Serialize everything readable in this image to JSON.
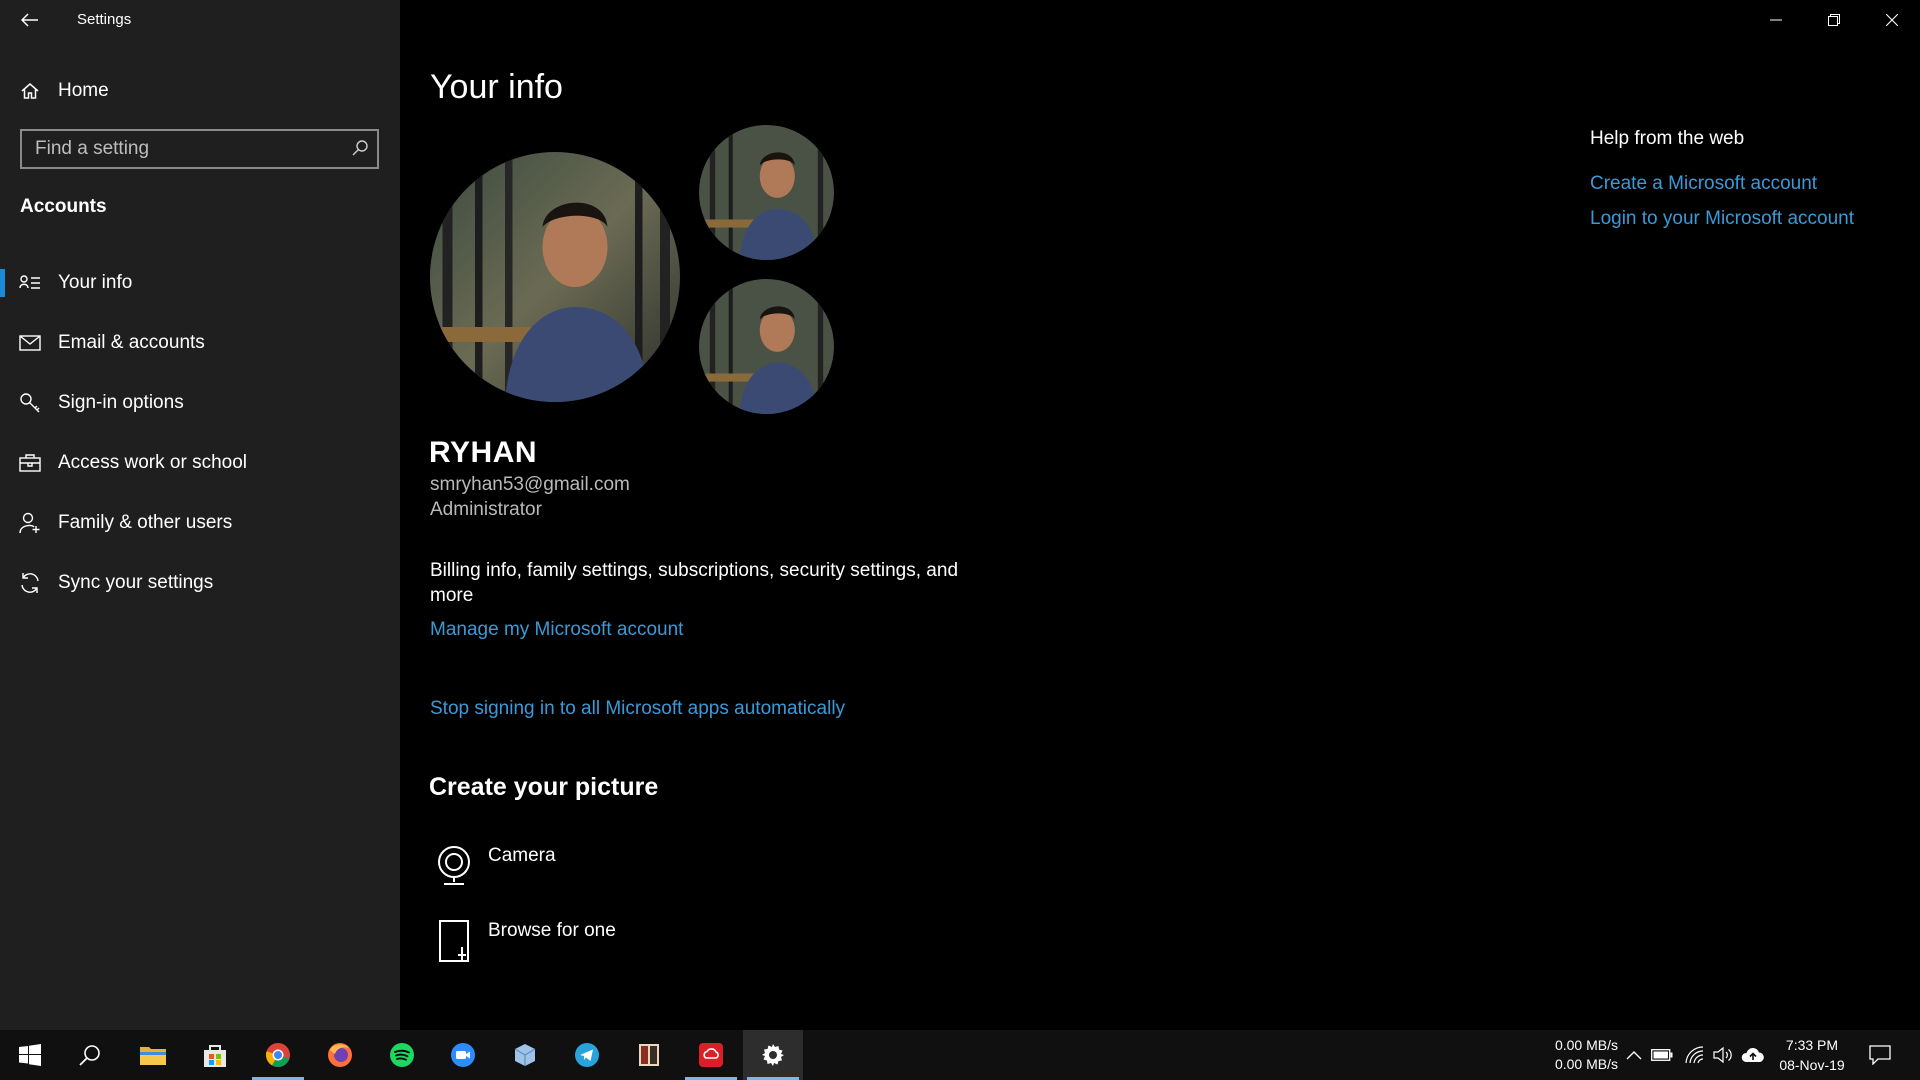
{
  "window": {
    "title": "Settings",
    "controls": [
      "minimize-icon",
      "restore-icon",
      "close-icon"
    ]
  },
  "sidebar": {
    "home_label": "Home",
    "search_placeholder": "Find a setting",
    "section_title": "Accounts",
    "items": [
      {
        "label": "Your info",
        "icon": "contact-info-icon",
        "active": true
      },
      {
        "label": "Email & accounts",
        "icon": "mail-icon",
        "active": false
      },
      {
        "label": "Sign-in options",
        "icon": "key-icon",
        "active": false
      },
      {
        "label": "Access work or school",
        "icon": "briefcase-icon",
        "active": false
      },
      {
        "label": "Family & other users",
        "icon": "add-person-icon",
        "active": false
      },
      {
        "label": "Sync your settings",
        "icon": "sync-icon",
        "active": false
      }
    ]
  },
  "main": {
    "title": "Your info",
    "user": {
      "name": "RYHAN",
      "email": "smryhan53@gmail.com",
      "role": "Administrator"
    },
    "billing_text": "Billing info, family settings, subscriptions, security settings, and more",
    "manage_link": "Manage my Microsoft account",
    "stop_link": "Stop signing in to all Microsoft apps automatically",
    "create_heading": "Create your picture",
    "picture_options": [
      {
        "label": "Camera",
        "icon": "camera-icon"
      },
      {
        "label": "Browse for one",
        "icon": "browse-icon"
      }
    ]
  },
  "help": {
    "heading": "Help from the web",
    "links": [
      "Create a Microsoft account",
      "Login to your Microsoft account"
    ]
  },
  "taskbar": {
    "apps": [
      "start-icon",
      "search-icon",
      "file-explorer-icon",
      "store-icon",
      "chrome-icon",
      "firefox-icon",
      "spotify-icon",
      "zoom-icon",
      "3d-box-icon",
      "telegram-icon",
      "app-icon",
      "creative-cloud-icon",
      "settings-gear-icon"
    ],
    "net_up": "0.00 MB/s",
    "net_down": "0.00 MB/s",
    "time": "7:33 PM",
    "date": "08-Nov-19",
    "colors": {
      "accent": "#3a9ad9",
      "active_indicator": "#76b9ed"
    }
  }
}
